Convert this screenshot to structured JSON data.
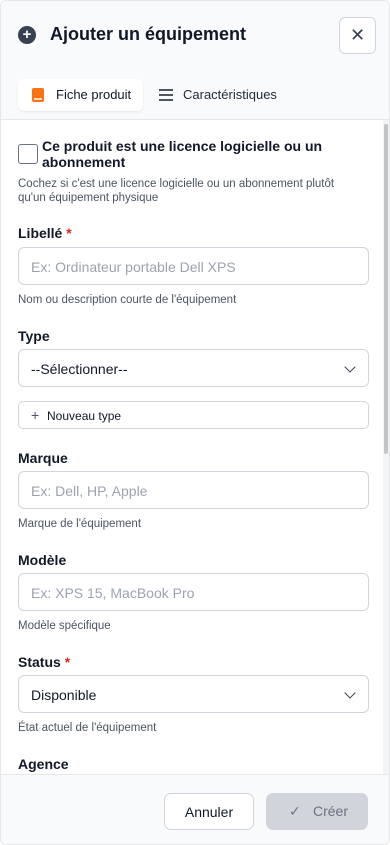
{
  "header": {
    "icon": "plus-circle-icon",
    "title": "Ajouter un équipement",
    "close_icon": "close-icon"
  },
  "tabs": [
    {
      "label": "Fiche produit",
      "icon": "book-icon",
      "active": true
    },
    {
      "label": "Caractéristiques",
      "icon": "list-icon",
      "active": false
    }
  ],
  "form": {
    "license_checkbox": {
      "label": "Ce produit est une licence logicielle ou un abonnement",
      "checked": false,
      "help": "Cochez si c'est une licence logicielle ou un abonnement plutôt qu'un équipement physique"
    },
    "libelle": {
      "label": "Libellé",
      "required_mark": "*",
      "placeholder": "Ex: Ordinateur portable Dell XPS",
      "help": "Nom ou description courte de l'équipement"
    },
    "type": {
      "label": "Type",
      "value": "--Sélectionner--",
      "new_type_label": "Nouveau type"
    },
    "marque": {
      "label": "Marque",
      "placeholder": "Ex: Dell, HP, Apple",
      "help": "Marque de l'équipement"
    },
    "modele": {
      "label": "Modèle",
      "placeholder": "Ex: XPS 15, MacBook Pro",
      "help": "Modèle spécifique"
    },
    "status": {
      "label": "Status",
      "required_mark": "*",
      "value": "Disponible",
      "help": "État actuel de l'équipement"
    },
    "agence": {
      "label": "Agence"
    }
  },
  "footer": {
    "cancel_label": "Annuler",
    "create_label": "Créer",
    "create_icon": "check-icon",
    "create_disabled": true
  },
  "colors": {
    "accent_tab_icon": "#f97316",
    "required": "#dc2626",
    "disabled_button": "#d1d5db"
  }
}
